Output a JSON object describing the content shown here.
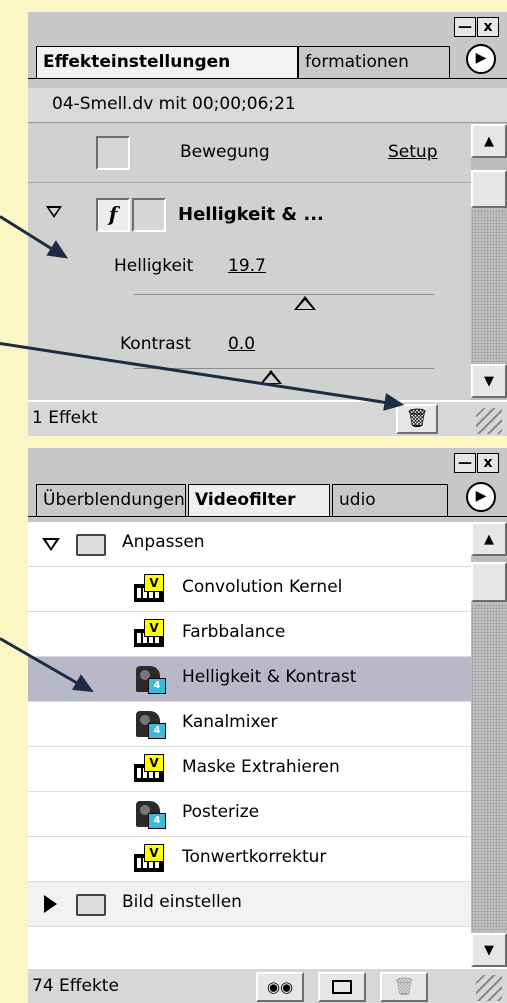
{
  "effect_panel": {
    "tabs": [
      "Effekteinstellungen",
      "formationen"
    ],
    "clip_info": "04-Smell.dv mit 00;00;06;21",
    "motion_row": {
      "label": "Bewegung",
      "setup": "Setup"
    },
    "effect": {
      "title": "Helligkeit & ...",
      "params": [
        {
          "label": "Helligkeit",
          "value": "19.7"
        },
        {
          "label": "Kontrast",
          "value": "0.0"
        }
      ]
    },
    "status": "1 Effekt",
    "window_buttons": {
      "minimize": "—",
      "close": "x"
    }
  },
  "filter_panel": {
    "tabs": [
      "Überblendungen",
      "Videofilter",
      "udio"
    ],
    "folder_open": "Anpassen",
    "items": [
      {
        "label": "Convolution Kernel",
        "icon": "v-filter-icon",
        "selected": false
      },
      {
        "label": "Farbbalance",
        "icon": "v-filter-icon",
        "selected": false
      },
      {
        "label": "Helligkeit & Kontrast",
        "icon": "ae-filter-icon",
        "selected": true
      },
      {
        "label": "Kanalmixer",
        "icon": "ae-filter-icon",
        "selected": false
      },
      {
        "label": "Maske Extrahieren",
        "icon": "v-filter-icon",
        "selected": false
      },
      {
        "label": "Posterize",
        "icon": "ae-filter-icon",
        "selected": false
      },
      {
        "label": "Tonwertkorrektur",
        "icon": "v-filter-icon",
        "selected": false
      }
    ],
    "folder_closed": "Bild einstellen",
    "status": "74 Effekte",
    "window_buttons": {
      "minimize": "—",
      "close": "x"
    }
  },
  "colors": {
    "background": "#fbf7c4",
    "panel": "#c7c7c7",
    "selection": "#b8b8c8",
    "arrow": "#1c2c44"
  }
}
